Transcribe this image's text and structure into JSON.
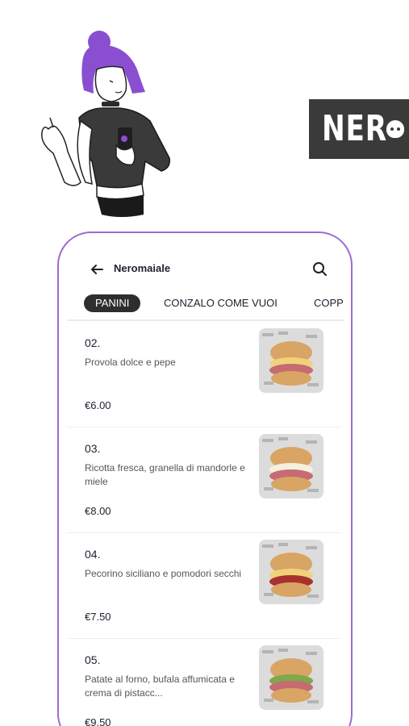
{
  "app": {
    "title": "Neromaiale",
    "back_icon": "arrow-left-icon",
    "search_icon": "search-icon"
  },
  "brand": {
    "logo_text": "NER"
  },
  "tabs": [
    {
      "label": "PANINI",
      "active": true
    },
    {
      "label": "CONZALO COME VUOI",
      "active": false
    },
    {
      "label": "COPP",
      "active": false
    }
  ],
  "items": [
    {
      "number": "02.",
      "description": "Provola dolce e pepe",
      "price": "€6.00"
    },
    {
      "number": "03.",
      "description": "Ricotta fresca, granella di mandorle e miele",
      "price": "€8.00"
    },
    {
      "number": "04.",
      "description": "Pecorino siciliano e pomodori secchi",
      "price": "€7.50"
    },
    {
      "number": "05.",
      "description": "Patate al forno, bufala affumicata e crema di pistacc...",
      "price": "€9.50"
    }
  ],
  "colors": {
    "phone_border": "#9d6bd3",
    "active_tab_bg": "#2e2e2e",
    "hair": "#8a4fd1",
    "logo_bg": "#3a3a3a"
  }
}
